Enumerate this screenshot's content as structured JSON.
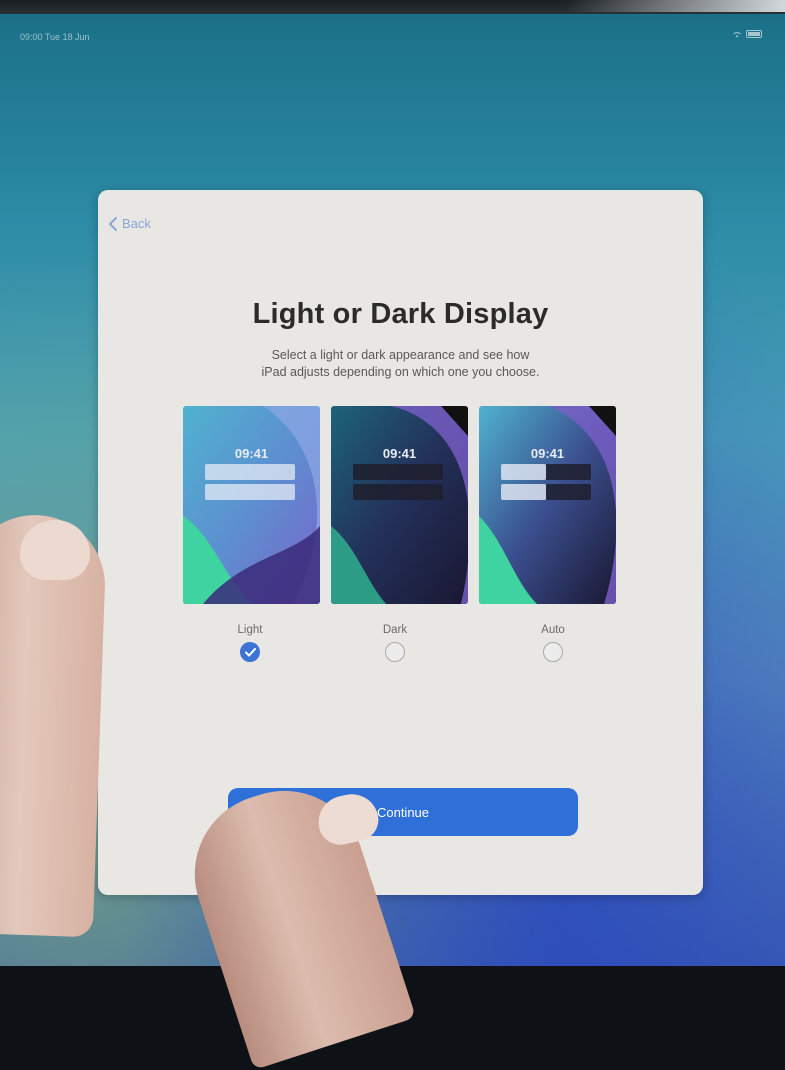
{
  "status_bar": {
    "left_text": "09:00 Tue 18 Jun"
  },
  "navigation": {
    "back_label": "Back"
  },
  "setup": {
    "title": "Light or Dark Display",
    "subtitle_line1": "Select a light or dark appearance and see how",
    "subtitle_line2": "iPad adjusts depending on which one you choose."
  },
  "previews": [
    {
      "mode": "light",
      "time": "09:41"
    },
    {
      "mode": "dark",
      "time": "09:41"
    },
    {
      "mode": "auto",
      "time": "09:41"
    }
  ],
  "options": [
    {
      "label": "Light",
      "selected": true
    },
    {
      "label": "Dark",
      "selected": false
    },
    {
      "label": "Auto",
      "selected": false
    }
  ],
  "continue_label": "Continue",
  "colors": {
    "accent": "#2f6fd8",
    "sheet_background": "#e9e7e4",
    "back_link": "#8aa6d6"
  },
  "icons": {
    "back": "chevron-left-icon",
    "selected": "checkmark-icon",
    "wifi": "wifi-icon",
    "battery": "battery-icon"
  }
}
